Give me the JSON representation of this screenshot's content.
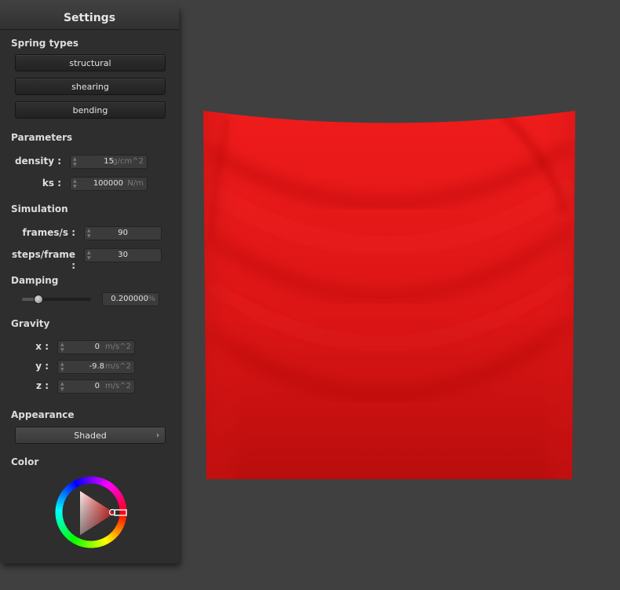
{
  "settings": {
    "title": "Settings",
    "spring_types": {
      "label": "Spring types",
      "buttons": [
        "structural",
        "shearing",
        "bending"
      ]
    },
    "parameters": {
      "label": "Parameters",
      "density": {
        "label": "density :",
        "value": "15",
        "unit": "g/cm^2"
      },
      "ks": {
        "label": "ks :",
        "value": "100000",
        "unit": "N/m"
      }
    },
    "simulation": {
      "label": "Simulation",
      "fps": {
        "label": "frames/s :",
        "value": "90"
      },
      "steps": {
        "label": "steps/frame :",
        "value": "30"
      }
    },
    "damping": {
      "label": "Damping",
      "slider_fraction": 0.2,
      "value": "0.200000",
      "unit": "%"
    },
    "gravity": {
      "label": "Gravity",
      "x": {
        "label": "x :",
        "value": "0",
        "unit": "m/s^2"
      },
      "y": {
        "label": "y :",
        "value": "-9.8",
        "unit": "m/s^2"
      },
      "z": {
        "label": "z :",
        "value": "0",
        "unit": "m/s^2"
      }
    },
    "appearance": {
      "label": "Appearance",
      "selected": "Shaded",
      "chevron_icon": "chevron-right-icon"
    },
    "color": {
      "label": "Color",
      "selected_hex": "#d41414"
    }
  },
  "cloth": {
    "color": "#d41414",
    "shadow_color": "#a00b0b"
  }
}
